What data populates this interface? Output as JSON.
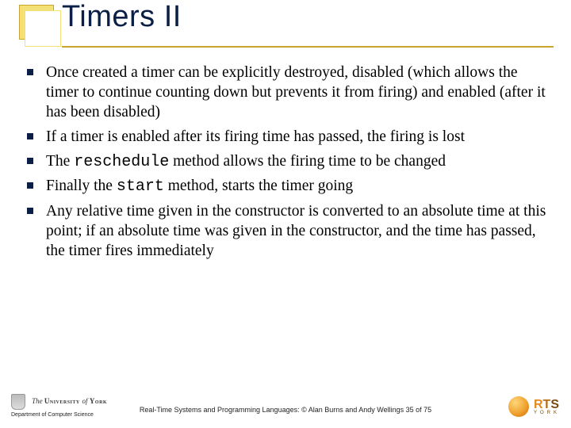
{
  "title": "Timers II",
  "bullets": [
    {
      "pre": "Once created a timer can be explicitly destroyed, disabled (which allows the timer to continue counting down but prevents it from firing) and enabled (after it has been disabled)"
    },
    {
      "pre": "If a timer is enabled after its firing time has passed, the firing is lost"
    },
    {
      "pre": "The ",
      "code": "reschedule",
      "post": " method allows the firing time to be changed"
    },
    {
      "pre": "Finally the ",
      "code": "start",
      "post": " method, starts the timer going"
    },
    {
      "pre": "Any relative time given in the constructor is converted to an absolute time at this point; if an absolute time was given in the constructor, and the time has passed, the timer fires immediately"
    }
  ],
  "footer": {
    "university_prefix": "The ",
    "university_of": "University ",
    "university_italic": "of",
    "university_york": " York",
    "department": "Department of Computer Science",
    "center": "Real-Time Systems and Programming Languages: © Alan Burns and Andy Wellings  35 of 75",
    "rts": {
      "r": "R",
      "t": "T",
      "s": "S",
      "sub": "YORK"
    }
  }
}
